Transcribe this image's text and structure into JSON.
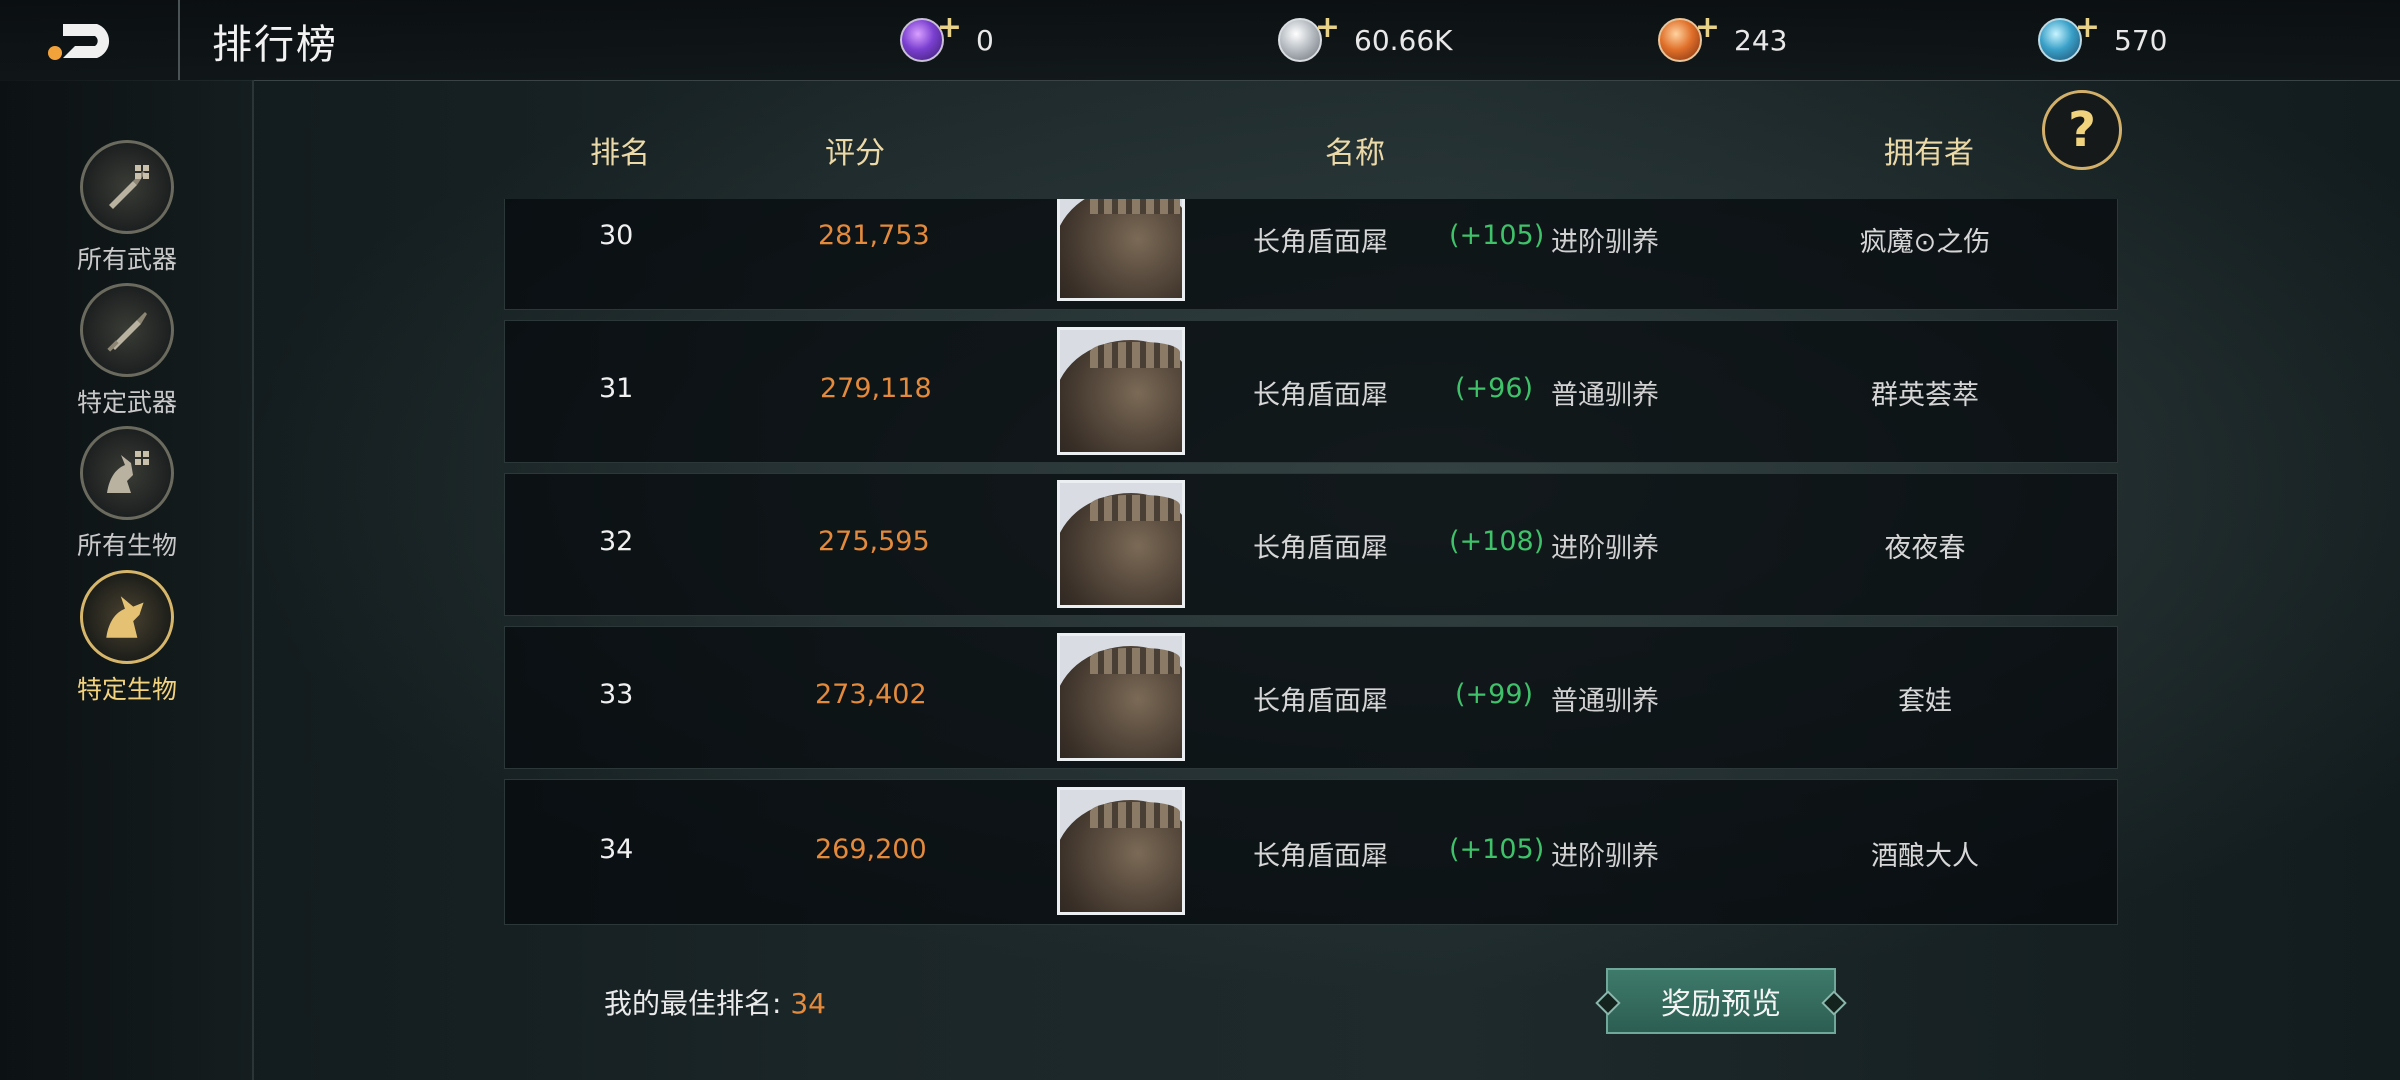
{
  "header": {
    "title": "排行榜"
  },
  "currencies": [
    {
      "icon": "purple-gem-icon",
      "value": "0"
    },
    {
      "icon": "silver-coin-icon",
      "value": "60.66K"
    },
    {
      "icon": "orange-token-icon",
      "value": "243"
    },
    {
      "icon": "blue-crystal-icon",
      "value": "570"
    }
  ],
  "sidebar": {
    "items": [
      {
        "label": "所有武器",
        "icon": "sword-grid-icon",
        "active": false
      },
      {
        "label": "特定武器",
        "icon": "sword-icon",
        "active": false
      },
      {
        "label": "所有生物",
        "icon": "creature-grid-icon",
        "active": false
      },
      {
        "label": "特定生物",
        "icon": "creature-icon",
        "active": true
      }
    ]
  },
  "table": {
    "columns": {
      "rank": "排名",
      "score": "评分",
      "name": "名称",
      "owner": "拥有者"
    },
    "rows": [
      {
        "rank": "30",
        "score": "281,753",
        "name": "长角盾面犀",
        "bonus": "(+105)",
        "training": "进阶驯养",
        "owner": "疯魔⊙之伤"
      },
      {
        "rank": "31",
        "score": "279,118",
        "name": "长角盾面犀",
        "bonus": "(+96)",
        "training": "普通驯养",
        "owner": "群英荟萃"
      },
      {
        "rank": "32",
        "score": "275,595",
        "name": "长角盾面犀",
        "bonus": "(+108)",
        "training": "进阶驯养",
        "owner": "夜夜春"
      },
      {
        "rank": "33",
        "score": "273,402",
        "name": "长角盾面犀",
        "bonus": "(+99)",
        "training": "普通驯养",
        "owner": "套娃"
      },
      {
        "rank": "34",
        "score": "269,200",
        "name": "长角盾面犀",
        "bonus": "(+105)",
        "training": "进阶驯养",
        "owner": "酒酿大人"
      }
    ]
  },
  "footer": {
    "best_label": "我的最佳排名:",
    "best_value": "34",
    "reward_button": "奖励预览"
  },
  "help_label": "?"
}
